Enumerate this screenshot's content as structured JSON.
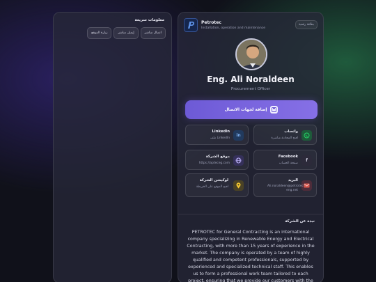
{
  "quick_info": {
    "title": "معلومات سريعة",
    "buttons": [
      {
        "label": "اتصال مباشر"
      },
      {
        "label": "إيميل مباشر"
      },
      {
        "label": "زيارة الموقع"
      }
    ]
  },
  "header": {
    "company": "Petrotec",
    "tagline": "Installation, operation and maintenance",
    "lang_button": "بطاقة رقمية"
  },
  "profile": {
    "name": "Eng. Ali Noraldeen",
    "role": "Procurement Officer"
  },
  "save_contact": {
    "label": "إضافة لجهات الاتصال"
  },
  "contacts": {
    "whatsapp": {
      "name": "واتساب",
      "value": "افتح المحادثة مباشرة"
    },
    "linkedin": {
      "name": "LinkedIn",
      "value": "ملف LinkedIn"
    },
    "facebook": {
      "name": "Facebook",
      "value": "صفحة الحساب"
    },
    "website": {
      "name": "موقع الشركة",
      "value": "https://apteceg.com"
    },
    "email": {
      "name": "البريد",
      "value": "Ali.noraldeen@petrotec-eng.net"
    },
    "location": {
      "name": "لوكيشن الشركة",
      "value": "افتح الموقع على الخريطة"
    }
  },
  "about": {
    "title": "نبذة عن الشركة",
    "text": "PETROTEC for General Contracting is an international company specializing in Renewable Energy and Electrical Contracting, with more than 15 years of experience in the market. The company is operated by a team of highly qualified and competent professionals, supported by experienced and specialized technical staff. This enables us to form a professional work team tailored to each project, ensuring that we provide our customers with the best possible service throughout all phases of the project."
  },
  "colors": {
    "accent": "#7a63e0",
    "whatsapp": "#25d366",
    "linkedin": "#2f6fc4",
    "email": "#d9584f",
    "location": "#f2c431"
  },
  "icons": [
    "logo-icon",
    "save-contact-icon",
    "whatsapp-icon",
    "linkedin-icon",
    "facebook-icon",
    "globe-icon",
    "email-icon",
    "location-pin-icon"
  ]
}
